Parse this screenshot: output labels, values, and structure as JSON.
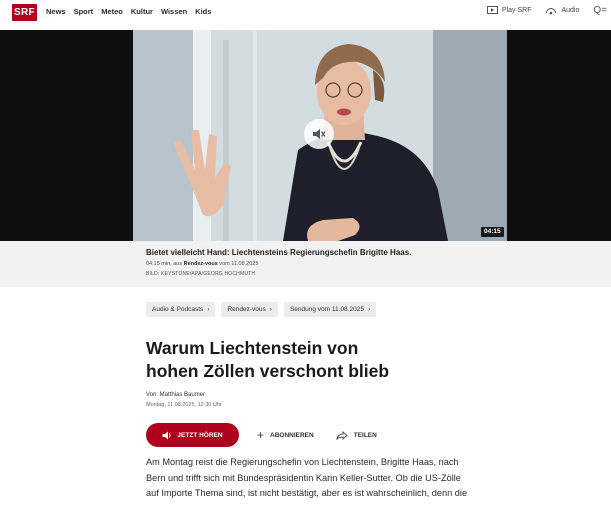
{
  "header": {
    "logo": "SRF",
    "nav": [
      "News",
      "Sport",
      "Meteo",
      "Kultur",
      "Wissen",
      "Kids"
    ],
    "play_label": "Play SRF",
    "audio_label": "Audio",
    "search_label": "Q="
  },
  "video": {
    "duration": "04:15",
    "mute_icon": "speaker-muted-icon"
  },
  "caption": {
    "title": "Bietet vielleicht Hand: Liechtensteins Regierungschefin Brigitte Haas.",
    "meta_prefix": "04:15 min, aus ",
    "meta_show": "Rendez-vous",
    "meta_suffix": " vom 11.08.2025",
    "credit": "BILD: KEYSTONE/APA/GEORG HOCHMUTH"
  },
  "breadcrumbs": [
    "Audio & Podcasts",
    "Rendez-vous",
    "Sendung vom 11.08.2025"
  ],
  "article": {
    "headline_line1": "Warum Liechtenstein von",
    "headline_line2": "hohen Zöllen verschont blieb",
    "author": "Von: Matthias Baumer",
    "date": "Montag, 11.08.2025, 12:30 Uhr",
    "play_label": "JETZT HÖREN",
    "subscribe_label": "ABONNIEREN",
    "share_label": "TEILEN",
    "body_line1": "Am Montag reist die Regierungschefin von Liechtenstein, Brigitte Haas, nach",
    "body_line2": "Bern und trifft sich mit Bundespräsidentin Karin Keller-Sutter. Ob die US-Zölle",
    "body_line3": "auf Importe Thema sind, ist nicht bestätigt, aber es ist wahrscheinlich, denn die"
  },
  "colors": {
    "brand": "#af001e",
    "video_bg": "#0e0e0e",
    "caption_bg": "#f2f2f2"
  }
}
